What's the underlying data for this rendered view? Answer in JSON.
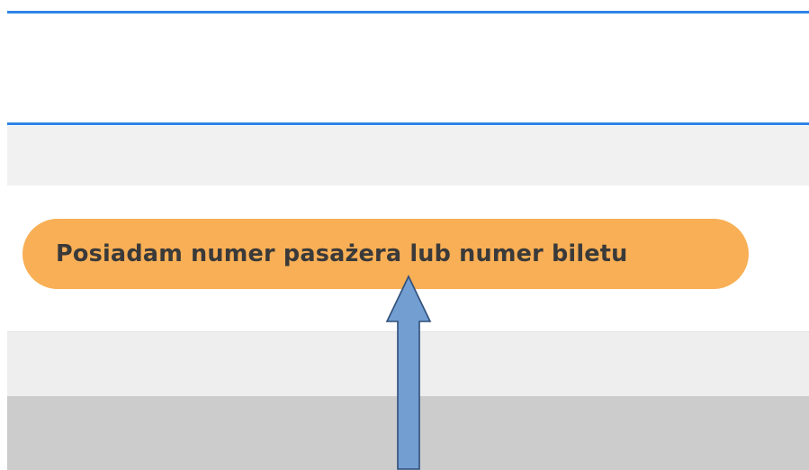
{
  "passenger_button": {
    "label": "Posiadam numer pasażera lub numer biletu"
  },
  "colors": {
    "rule": "#2f84e6",
    "button_fill": "#f8af55",
    "button_text": "#3a3a3a",
    "arrow_fill": "#729ed2",
    "arrow_stroke": "#2f4e79",
    "band_light": "#f1f1f1",
    "band_dark": "#cccccc"
  },
  "annotation": {
    "icon": "arrow-up-icon"
  }
}
